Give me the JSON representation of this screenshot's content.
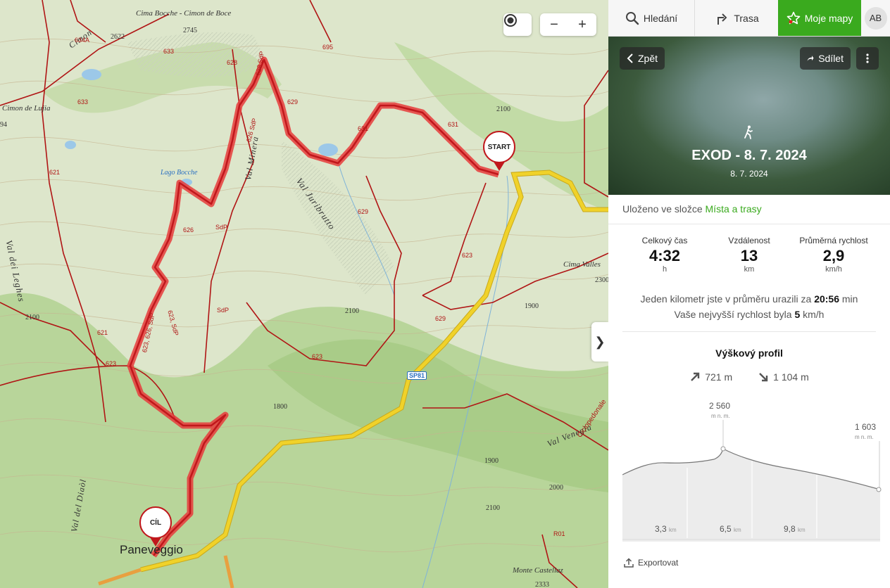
{
  "map": {
    "peak_labels": [
      {
        "id": "cima-bocche",
        "text": "Cima Bocche - Cimon de Boce"
      },
      {
        "id": "cimon-lujia",
        "text": "Cimon de Lujia"
      },
      {
        "id": "lago-bocche",
        "text": "Lago Bocche"
      },
      {
        "id": "cima-valles",
        "text": "Cima Valles"
      },
      {
        "id": "monte-castellaz",
        "text": "Monte Castellaz"
      },
      {
        "id": "paneveggio",
        "text": "Paneveggio"
      }
    ],
    "elevations": [
      "2745",
      "2622",
      "2100",
      "2100",
      "2100",
      "1800",
      "1900",
      "2000",
      "2100",
      "2333",
      "2300",
      "1900",
      "94"
    ],
    "valleys": [
      "Val dei Leghes",
      "Val Juribrutto",
      "Val Minera",
      "Val del Diaòl",
      "Val Venegia",
      "Cimon"
    ],
    "trail_numbers": [
      "634A",
      "633",
      "633",
      "628",
      "628 SdP",
      "695",
      "626 SdP",
      "629",
      "631",
      "631",
      "621",
      "626",
      "SdP",
      "629",
      "623",
      "629",
      "623",
      "SdP",
      "623, SdP",
      "623, 626, SdP",
      "621",
      "623",
      "R01"
    ],
    "road_label": "SP81",
    "cyclepath_label": "Ciclopedonale",
    "start_label": "START",
    "end_label": "CÍL",
    "controls": {
      "minus": "−",
      "plus": "+"
    },
    "collapse": "❯"
  },
  "topbar": {
    "search": "Hledání",
    "route": "Trasa",
    "mymaps": "Moje mapy",
    "avatar": "AB"
  },
  "hero": {
    "back": "Zpět",
    "share": "Sdílet",
    "title": "EXOD - 8. 7. 2024",
    "date": "8. 7. 2024"
  },
  "folder": {
    "prefix": "Uloženo ve složce",
    "link": "Místa a trasy"
  },
  "stats": [
    {
      "label": "Celkový čas",
      "value": "4:32",
      "unit": "h"
    },
    {
      "label": "Vzdálenost",
      "value": "13",
      "unit": "km"
    },
    {
      "label": "Průměrná rychlost",
      "value": "2,9",
      "unit": "km/h"
    }
  ],
  "info": {
    "line1_pre": "Jeden kilometr jste v průměru urazili za",
    "line1_val": "20:56",
    "line1_unit": "min",
    "line2_pre": "Vaše nejvyšší rychlost byla",
    "line2_val": "5",
    "line2_unit": "km/h"
  },
  "profile": {
    "title": "Výškový profil",
    "ascent": "721 m",
    "descent": "1 104 m",
    "max_value": "2 560",
    "max_unit": "m n. m.",
    "end_value": "1 603",
    "end_unit": "m n. m.",
    "km_ticks": [
      {
        "v": "3,3",
        "u": "km"
      },
      {
        "v": "6,5",
        "u": "km"
      },
      {
        "v": "9,8",
        "u": "km"
      }
    ]
  },
  "export": "Exportovat",
  "colors": {
    "accent": "#3aaa1e",
    "track": "#d81e1e",
    "road": "#f0d22a"
  }
}
